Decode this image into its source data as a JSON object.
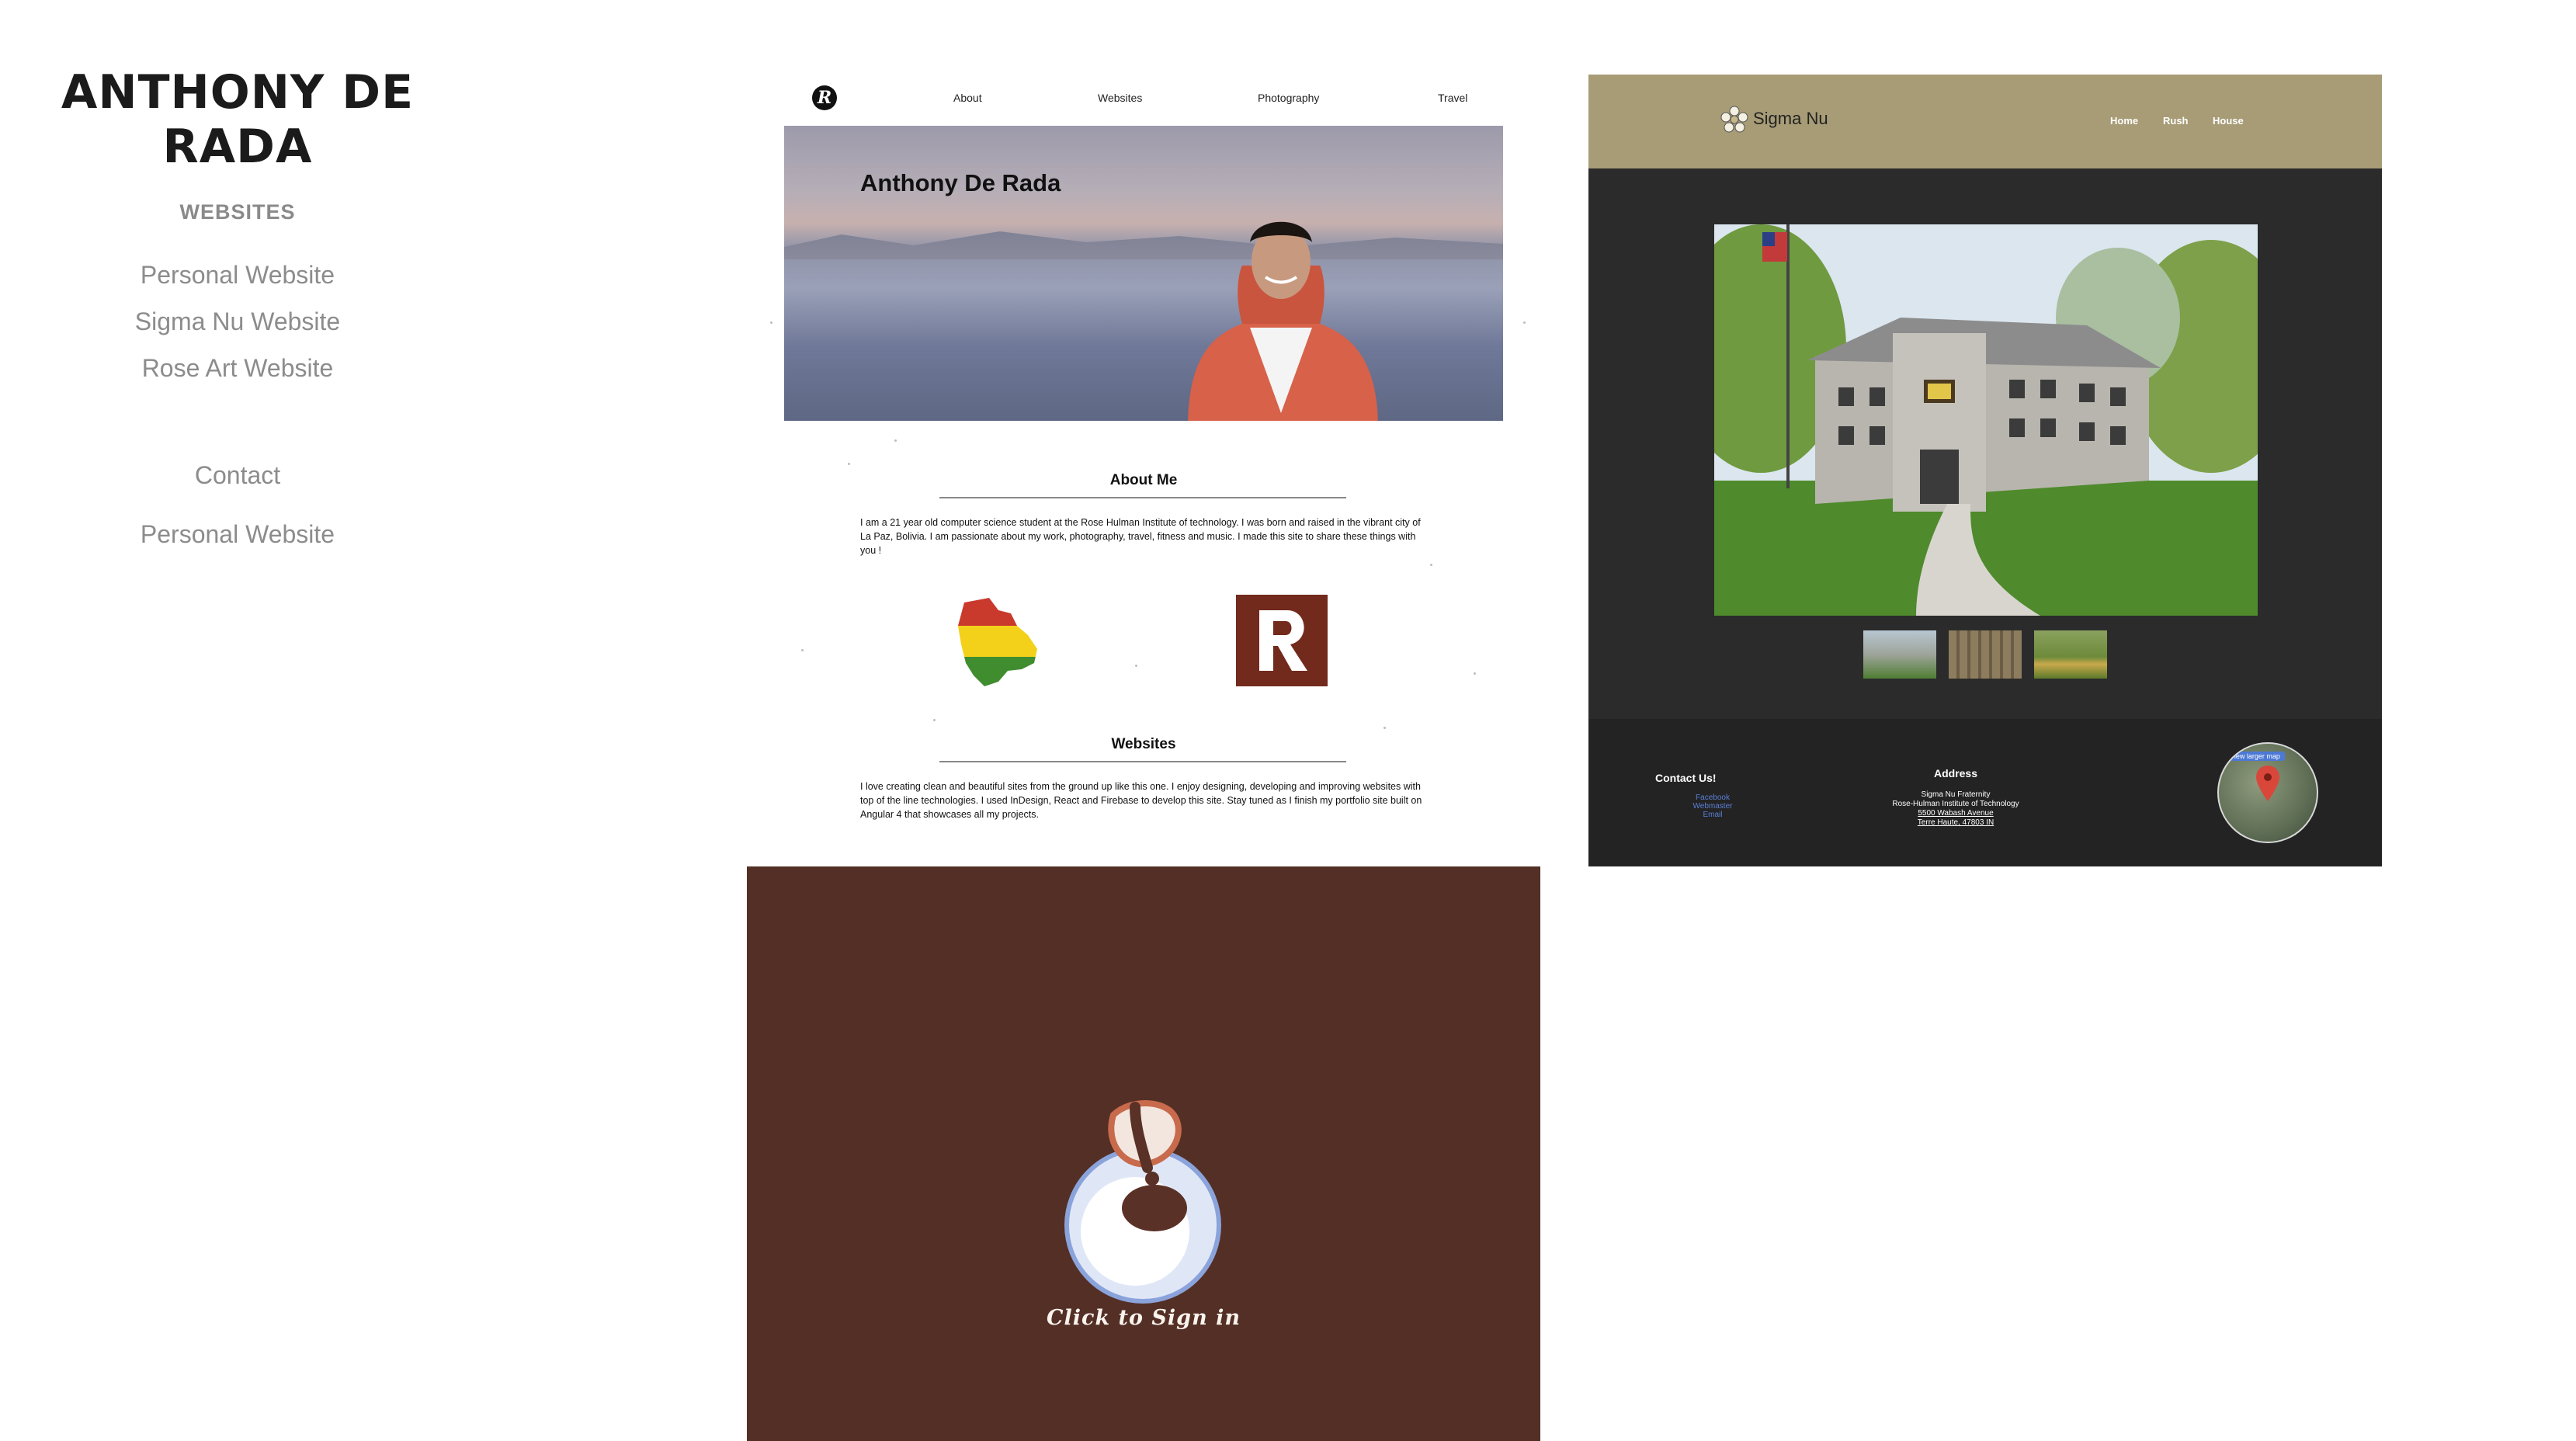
{
  "header": {
    "title": "ANTHONY DE RADA"
  },
  "nav": {
    "heading": "WEBSITES",
    "items": [
      {
        "label": "Personal Website"
      },
      {
        "label": "Sigma Nu Website"
      },
      {
        "label": "Rose Art Website"
      }
    ],
    "contact_label": "Contact",
    "contact_item": "Personal Website"
  },
  "thumbnails": {
    "personal": {
      "logo": "R",
      "nav": [
        "About",
        "Websites",
        "Photography",
        "Travel"
      ],
      "hero_name": "Anthony De Rada",
      "about_heading": "About Me",
      "about_text": "I am a 21 year old computer science student at the Rose Hulman Institute of technology. I was born and raised in the vibrant city of La Paz, Bolivia. I am passionate about my work, photography, travel, fitness and music. I made this site to share these things with you !",
      "websites_heading": "Websites",
      "websites_text": "I love creating clean and beautiful sites from the ground up like this one. I enjoy designing, developing and improving websites with top of the line technologies. I used InDesign, React and Firebase to develop this site. Stay tuned as I finish my portfolio site built on Angular 4 that showcases all my projects.",
      "badge": "R"
    },
    "sigma": {
      "brand": "Sigma  Nu",
      "nav": [
        "Home",
        "Rush",
        "House"
      ],
      "contact_heading": "Contact Us!",
      "contact_links": [
        "Facebook",
        "Webmaster",
        "Email"
      ],
      "address_heading": "Address",
      "address_lines": [
        "Sigma Nu Fraternity",
        "Rose-Hulman Institute of Technology",
        "5500 Wabash Avenue",
        "Terre Haute, 47803 IN"
      ],
      "map_label": "View larger map"
    },
    "rose": {
      "signin": "Click to Sign in"
    }
  },
  "colors": {
    "title": "#1b1b1b",
    "nav_text": "#8c8c8c",
    "sigma_header": "#a79c76",
    "sigma_body": "#2b2b2b",
    "rose_bg": "#532f25",
    "badge": "#722a1c"
  }
}
